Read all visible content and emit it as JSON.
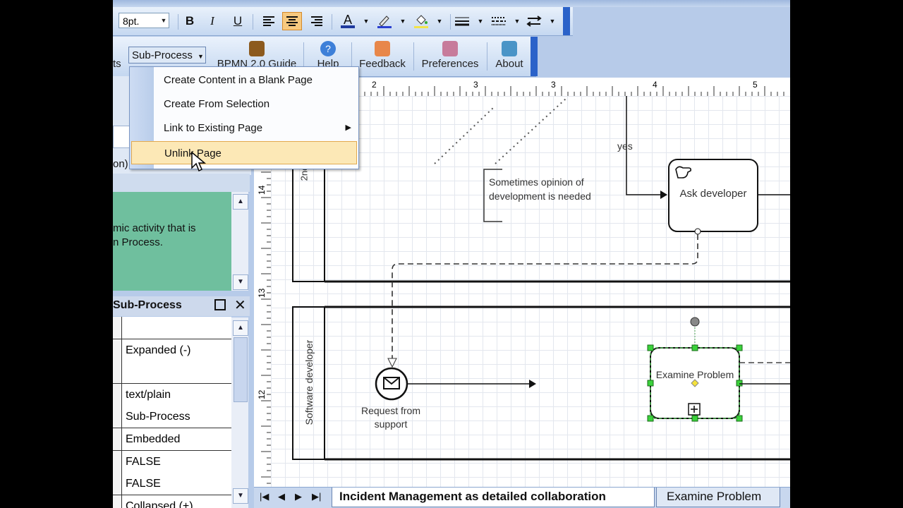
{
  "toolbar": {
    "font_size": "8pt.",
    "bold": "B",
    "italic": "I",
    "underline": "U",
    "font_color_glyph": "A"
  },
  "ribbon": {
    "subprocess_label": "Sub-Process",
    "partial_left": "ts",
    "bpmn_guide": "BPMN 2.0 Guide",
    "help": "Help",
    "feedback": "Feedback",
    "preferences": "Preferences",
    "about": "About"
  },
  "menu": {
    "items": [
      {
        "label": "Create Content in a Blank Page"
      },
      {
        "label": "Create From Selection"
      },
      {
        "label": "Link to Existing Page"
      },
      {
        "label": "Unlink Page"
      }
    ]
  },
  "left_pane": {
    "partial_text": "on)",
    "help_text_line1": "mic activity that is",
    "help_text_line2": "n Process."
  },
  "properties": {
    "title": "Sub-Process",
    "rows": [
      "",
      "Expanded (-)",
      "",
      "text/plain",
      "Sub-Process",
      "Embedded",
      "FALSE",
      "FALSE",
      "Collapsed (+)"
    ]
  },
  "diagram": {
    "ruler_top": [
      "2",
      "3",
      "3",
      "4",
      "5"
    ],
    "ruler_left": [
      "14",
      "13",
      "12"
    ],
    "lane1_label": "2nd",
    "lane2_label": "Software developer",
    "annotation": "Sometimes opinion of development is needed",
    "yes_label": "yes",
    "task_ask_developer": "Ask developer",
    "subprocess_examine": "Examine Problem",
    "start_event_label": "Request from support"
  },
  "tabs": {
    "active": "Incident Management as detailed collaboration",
    "other": "Examine Problem"
  },
  "colors": {
    "menu_highlight": "#fce8b6",
    "help_panel": "#6fbf9e",
    "toolbar_blue": "#2b62c9"
  }
}
